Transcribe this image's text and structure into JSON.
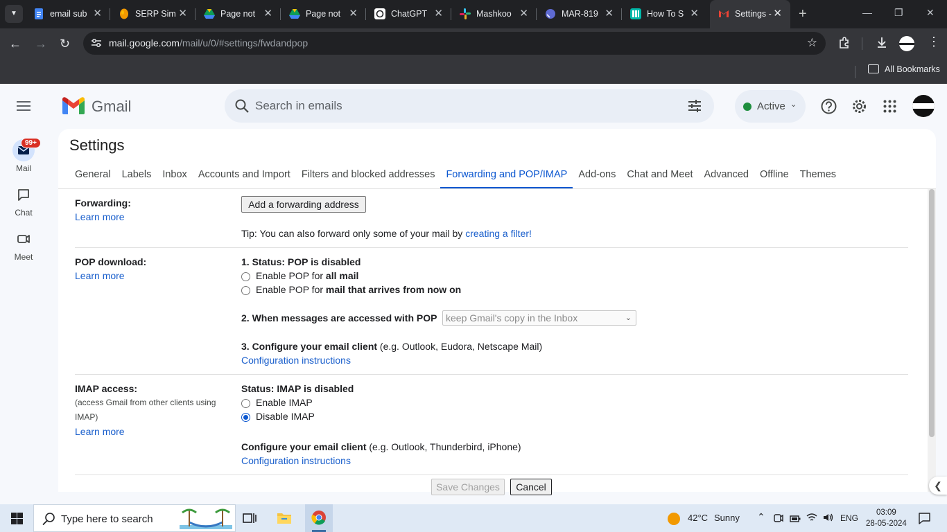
{
  "browser": {
    "tabs": [
      {
        "title": "email sub",
        "icon": "google-docs-icon",
        "color": "#4285f4"
      },
      {
        "title": "SERP Sim",
        "icon": "serp-simulator-icon",
        "color": "#f29900"
      },
      {
        "title": "Page not",
        "icon": "google-drive-icon",
        "color": "#0f9d58"
      },
      {
        "title": "Page not",
        "icon": "google-drive-icon",
        "color": "#0f9d58"
      },
      {
        "title": "ChatGPT",
        "icon": "chatgpt-icon",
        "color": "#ffffff"
      },
      {
        "title": "Mashkoo",
        "icon": "slack-icon",
        "color": "#e01e5a"
      },
      {
        "title": "MAR-819",
        "icon": "linear-icon",
        "color": "#5e6ad2"
      },
      {
        "title": "How To S",
        "icon": "tab-app-icon",
        "color": "#00b8a9"
      },
      {
        "title": "Settings -",
        "icon": "gmail-icon",
        "color": "#ea4335",
        "active": true
      }
    ],
    "url_domain": "mail.google.com",
    "url_path": "/mail/u/0/#settings/fwdandpop",
    "bookmarks_label": "All Bookmarks"
  },
  "gmail": {
    "brand": "Gmail",
    "search_placeholder": "Search in emails",
    "status": "Active",
    "status_color": "#1e8e3e",
    "rail": [
      {
        "label": "Mail",
        "icon": "mail-icon",
        "badge": "99+"
      },
      {
        "label": "Chat",
        "icon": "chat-icon"
      },
      {
        "label": "Meet",
        "icon": "video-icon"
      }
    ]
  },
  "settings": {
    "title": "Settings",
    "tabs": [
      "General",
      "Labels",
      "Inbox",
      "Accounts and Import",
      "Filters and blocked addresses",
      "Forwarding and POP/IMAP",
      "Add-ons",
      "Chat and Meet",
      "Advanced",
      "Offline",
      "Themes"
    ],
    "active_tab": "Forwarding and POP/IMAP",
    "accent": "#0b57d0",
    "forwarding": {
      "label": "Forwarding:",
      "learn_more": "Learn more",
      "add_button": "Add a forwarding address",
      "tip_prefix": "Tip: You can also forward only some of your mail by ",
      "tip_link": "creating a filter!"
    },
    "pop": {
      "label": "POP download:",
      "learn_more": "Learn more",
      "status": "1. Status: POP is disabled",
      "option_all_prefix": "Enable POP for ",
      "option_all_bold": "all mail",
      "option_new_prefix": "Enable POP for ",
      "option_new_bold": "mail that arrives from now on",
      "when_accessed": "2. When messages are accessed with POP",
      "when_value": "keep Gmail's copy in the Inbox",
      "configure_bold": "3. Configure your email client",
      "configure_hint": " (e.g. Outlook, Eudora, Netscape Mail)",
      "config_link": "Configuration instructions"
    },
    "imap": {
      "label": "IMAP access:",
      "sub_label": "(access Gmail from other clients using IMAP)",
      "learn_more": "Learn more",
      "status": "Status: IMAP is disabled",
      "enable": "Enable IMAP",
      "disable": "Disable IMAP",
      "selected": "Disable IMAP",
      "configure_bold": "Configure your email client",
      "configure_hint": " (e.g. Outlook, Thunderbird, iPhone)",
      "config_link": "Configuration instructions"
    },
    "save_button": "Save Changes",
    "cancel_button": "Cancel"
  },
  "taskbar": {
    "search_placeholder": "Type here to search",
    "weather_temp": "42°C",
    "weather_desc": "Sunny",
    "language": "ENG",
    "time": "03:09",
    "date": "28-05-2024"
  }
}
